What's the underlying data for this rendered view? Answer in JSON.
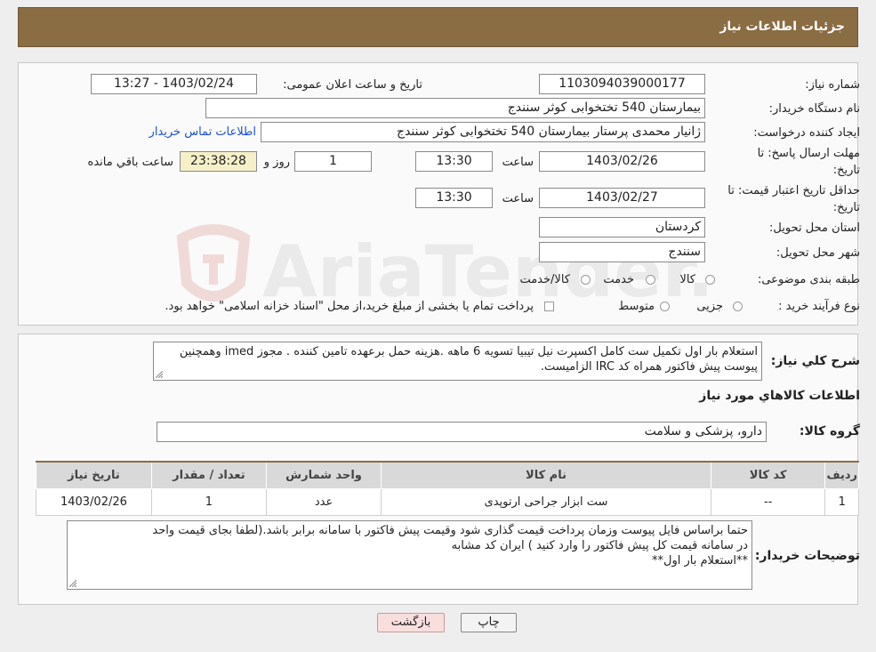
{
  "header": {
    "title": "جزئیات اطلاعات نیاز"
  },
  "form": {
    "need_number_label": "شماره نیاز:",
    "need_number": "1103094039000177",
    "announce_label": "تاریخ و ساعت اعلان عمومی:",
    "announce_value": "1403/02/24 - 13:27",
    "buyer_org_label": "نام دستگاه خریدار:",
    "buyer_org": "بیمارستان 540 تختخوابی کوثر سنندج",
    "creator_label": "ایجاد کننده درخواست:",
    "creator": "ژانیار محمدی پرستار بیمارستان 540 تختخوابی کوثر سنندج",
    "contact_link": "اطلاعات تماس خریدار",
    "deadline_label_1": "مهلت ارسال پاسخ: تا",
    "deadline_label_2": "تاریخ:",
    "deadline_date": "1403/02/26",
    "time_label": "ساعت",
    "deadline_time": "13:30",
    "days_value": "1",
    "days_label": "روز و",
    "remaining_value": "23:38:28",
    "remaining_label": "ساعت باقي مانده",
    "validity_label_1": "حداقل تاریخ اعتبار قیمت: تا",
    "validity_label_2": "تاریخ:",
    "validity_date": "1403/02/27",
    "validity_time": "13:30",
    "province_label": "استان محل تحویل:",
    "province": "کردستان",
    "city_label": "شهر محل تحویل:",
    "city": "سنندج",
    "category_label": "طبقه بندی موضوعی:",
    "category_options": [
      "کالا",
      "خدمت",
      "کالا/خدمت"
    ],
    "process_label": "نوع فرآیند خرید :",
    "process_options": [
      "جزیی",
      "متوسط"
    ],
    "process_note": "پرداخت تمام یا بخشی از مبلغ خرید،از محل \"اسناد خزانه اسلامی\" خواهد بود."
  },
  "details": {
    "summary_label": "شرح کلي نياز:",
    "summary_text": "استعلام بار اول تکمیل ست کامل اکسپرت نیل تیبیا تسویه 6 ماهه .هزینه حمل برعهده تامین کننده . مجوز imed وهمچنین پیوست پیش فاکتور همراه کد IRC  الزامیست.",
    "items_heading": "اطلاعات کالاهاي مورد نياز",
    "group_label": "گروه کالا:",
    "group_value": "دارو، پزشکی و سلامت",
    "table": {
      "headers": [
        "رديف",
        "کد کالا",
        "نام کالا",
        "واحد شمارش",
        "تعداد / مقدار",
        "تاريخ نياز"
      ],
      "rows": [
        [
          "1",
          "--",
          "ست ابزار جراحی ارتوپدی",
          "عدد",
          "1",
          "1403/02/26"
        ]
      ]
    },
    "buyer_notes_label": "توضیحات خریدار:",
    "buyer_notes_line1": "حتما براساس فایل پیوست  وزمان پرداخت قیمت گذاری شود وقیمت پیش فاکتور با سامانه برابر باشد.(لطفا بجای قیمت واحد",
    "buyer_notes_line2": "در سامانه قیمت کل پیش فاکتور را وارد کنید ) ایران کد مشابه",
    "buyer_notes_line3": "**استعلام بار اول**"
  },
  "buttons": {
    "print": "چاپ",
    "back": "بازگشت"
  },
  "watermark": {
    "text": "AriaTender.neT"
  }
}
